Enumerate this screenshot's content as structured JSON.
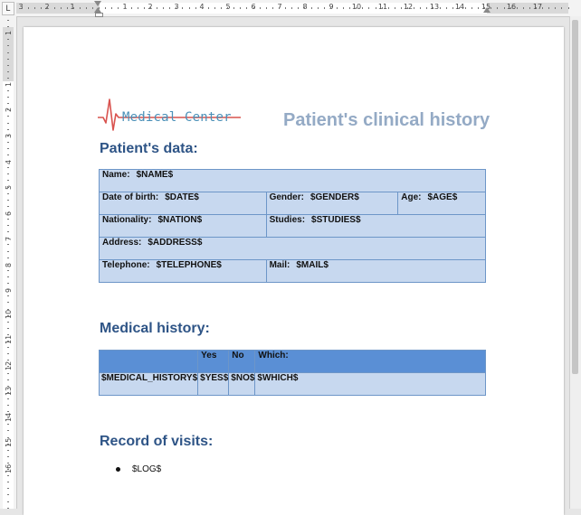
{
  "ruler": {
    "tab_selector": "L",
    "horizontal_numbers": [
      "3",
      "2",
      "1",
      "1",
      "2",
      "3",
      "4",
      "5",
      "6",
      "7",
      "8",
      "9",
      "10",
      "11",
      "12",
      "13",
      "14",
      "15",
      "16",
      "17"
    ],
    "vertical_numbers": [
      "1",
      "1",
      "2",
      "3",
      "4",
      "5",
      "6",
      "7",
      "8",
      "9",
      "10",
      "11",
      "12",
      "13",
      "14",
      "15",
      "16"
    ]
  },
  "document": {
    "logo_text": "Medical Center",
    "title": "Patient's clinical history",
    "patient_section": {
      "heading": "Patient's data:",
      "name_label": "Name:",
      "name_value": "$NAME$",
      "dob_label": "Date of birth:",
      "dob_value": "$DATE$",
      "gender_label": "Gender:",
      "gender_value": "$GENDER$",
      "age_label": "Age:",
      "age_value": "$AGE$",
      "nationality_label": "Nationality:",
      "nationality_value": "$NATION$",
      "studies_label": "Studies:",
      "studies_value": "$STUDIES$",
      "address_label": "Address:",
      "address_value": "$ADDRESS$",
      "telephone_label": "Telephone:",
      "telephone_value": "$TELEPHONE$",
      "mail_label": "Mail:",
      "mail_value": "$MAIL$"
    },
    "medical_section": {
      "heading": "Medical history:",
      "columns": [
        "",
        "Yes",
        "No",
        "Which:"
      ],
      "row": [
        "$MEDICAL_HISTORY$",
        "$YES$",
        "$NO$",
        "$WHICH$"
      ]
    },
    "visits_section": {
      "heading": "Record of visits:",
      "items": [
        "$LOG$"
      ]
    }
  },
  "colors": {
    "heading": "#2e5486",
    "title": "#94aac5",
    "cell_fill": "#c7d8ef",
    "header_fill": "#5a8fd5",
    "logo_pulse": "#d9534f",
    "logo_text": "#4a90b8"
  }
}
